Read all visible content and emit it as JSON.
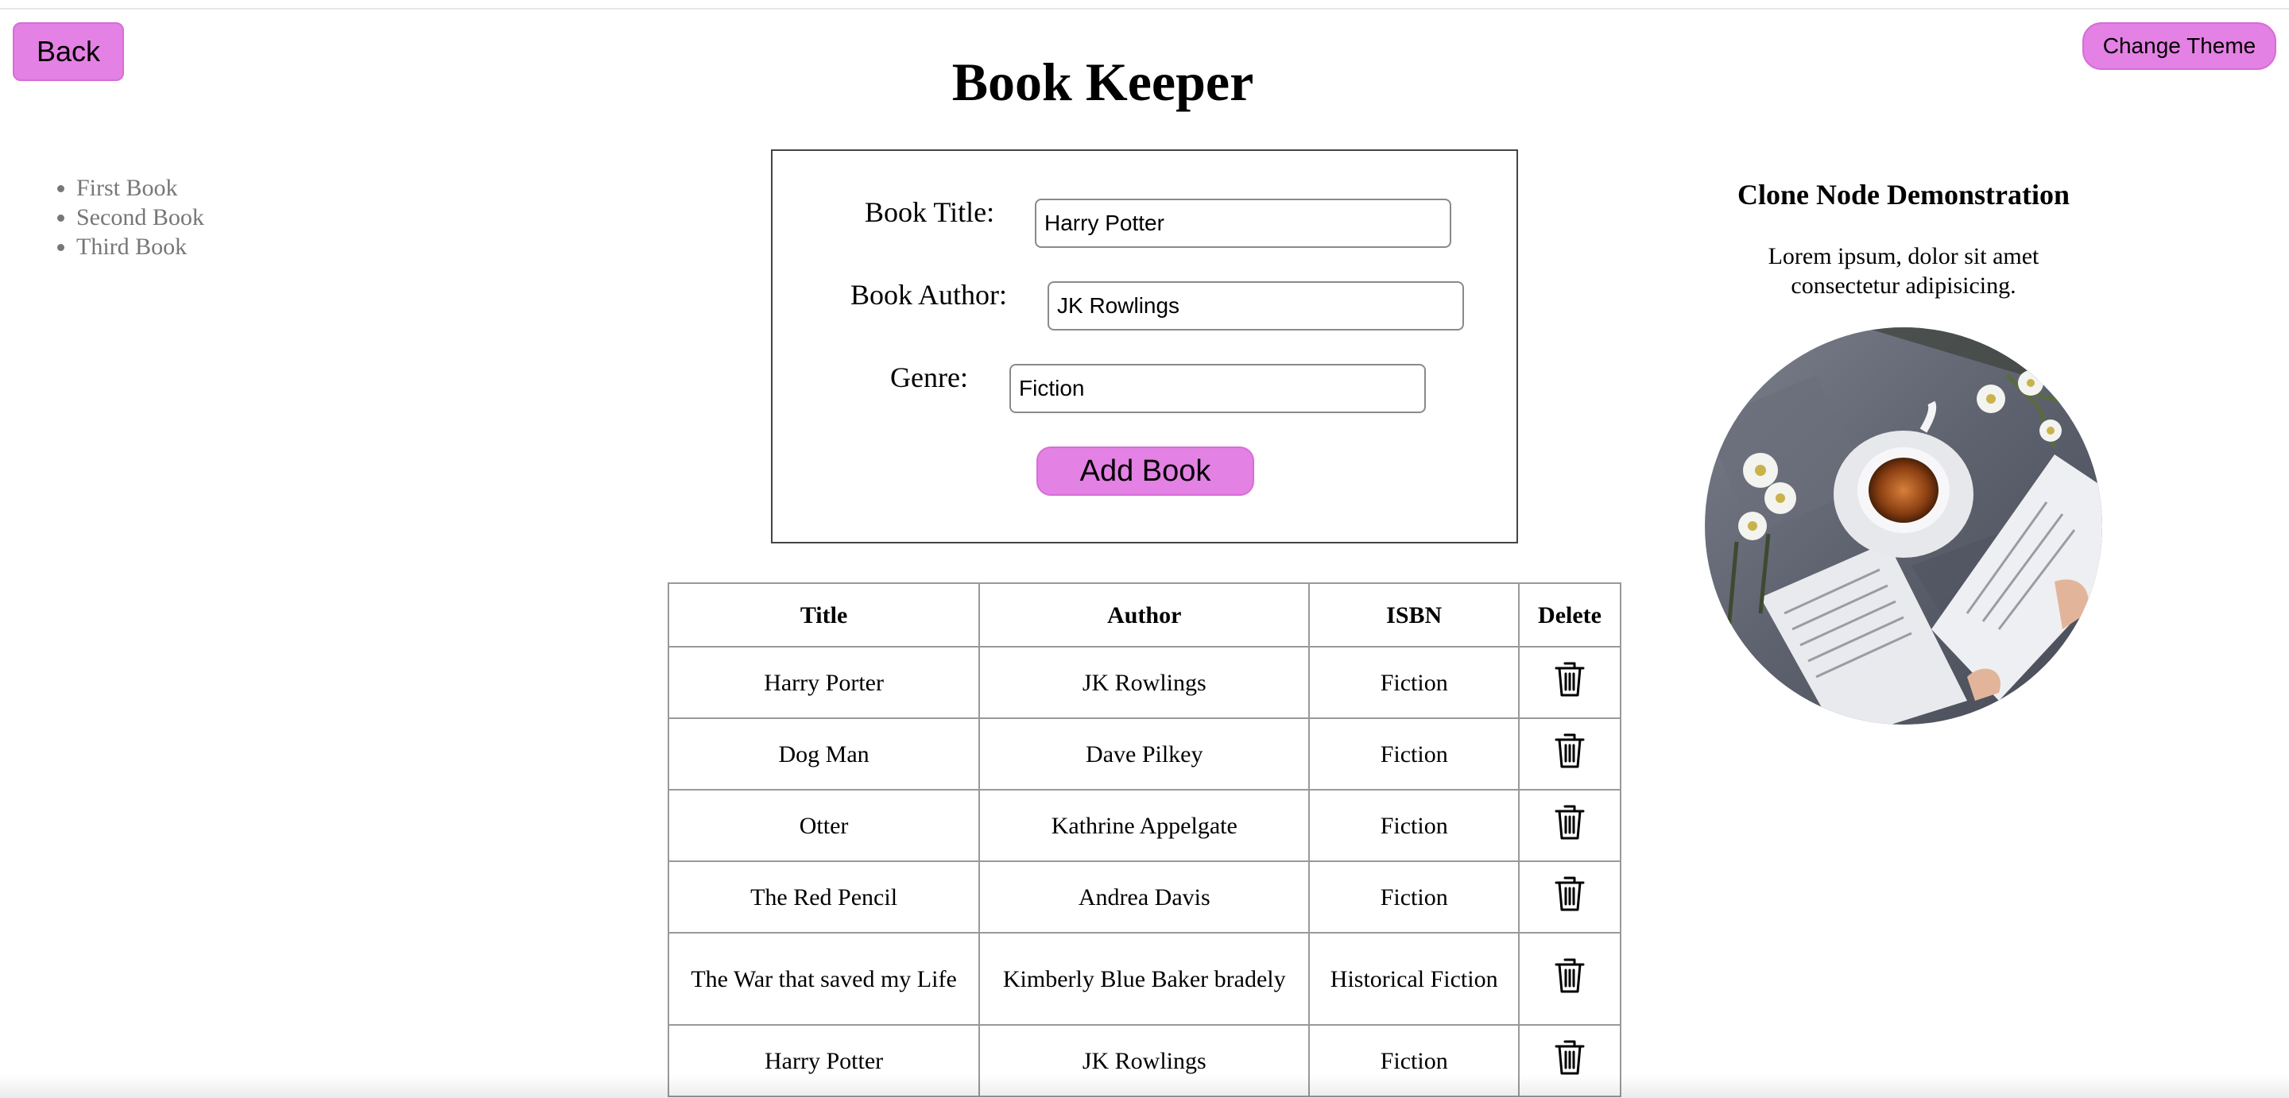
{
  "header": {
    "back_label": "Back",
    "theme_label": "Change Theme",
    "title": "Book Keeper"
  },
  "sidebar": {
    "items": [
      "First Book",
      "Second Book",
      "Third Book"
    ]
  },
  "form": {
    "title_label": "Book Title:",
    "title_value": "Harry Potter",
    "author_label": "Book Author:",
    "author_value": "JK Rowlings",
    "genre_label": "Genre:",
    "genre_value": "Fiction",
    "submit_label": "Add Book"
  },
  "table": {
    "headers": [
      "Title",
      "Author",
      "ISBN",
      "Delete"
    ],
    "rows": [
      {
        "title": "Harry Porter",
        "author": "JK Rowlings",
        "isbn": "Fiction"
      },
      {
        "title": "Dog Man",
        "author": "Dave Pilkey",
        "isbn": "Fiction"
      },
      {
        "title": "Otter",
        "author": "Kathrine Appelgate",
        "isbn": "Fiction"
      },
      {
        "title": "The Red Pencil",
        "author": "Andrea Davis",
        "isbn": "Fiction"
      },
      {
        "title": "The War that saved my Life",
        "author": "Kimberly Blue Baker bradely",
        "isbn": "Historical Fiction"
      },
      {
        "title": "Harry Potter",
        "author": "JK Rowlings",
        "isbn": "Fiction"
      }
    ]
  },
  "demo": {
    "title": "Clone Node Demonstration",
    "text": "Lorem ipsum, dolor sit amet consectetur adipisicing."
  },
  "icons": {
    "delete": "trash-icon",
    "list_bullet": "bullet-dot"
  },
  "colors": {
    "accent": "#e481e4",
    "border": "#999999",
    "link_muted": "#777777"
  }
}
